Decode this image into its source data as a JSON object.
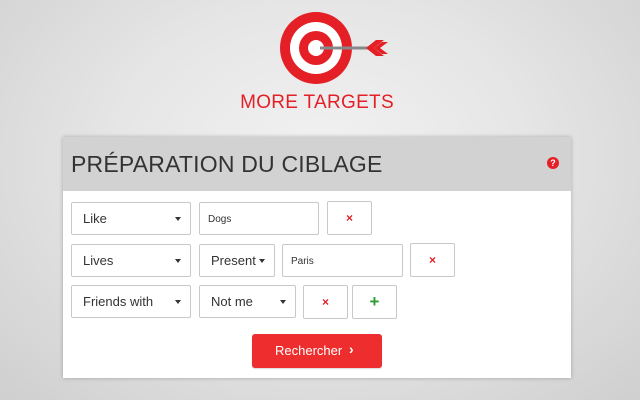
{
  "brand": {
    "name": "MORE TARGETS",
    "color": "#e41f26"
  },
  "panel": {
    "title": "PRÉPARATION DU CIBLAGE",
    "help_icon": "?"
  },
  "rows": [
    {
      "criterion": "Like",
      "value": "Dogs",
      "remove_icon": "×"
    },
    {
      "criterion": "Lives",
      "tense": "Present",
      "value": "Paris",
      "remove_icon": "×"
    },
    {
      "criterion": "Friends with",
      "who": "Not me",
      "remove_icon": "×",
      "add_icon": "+"
    }
  ],
  "search": {
    "label": "Rechercher",
    "icon": "›",
    "color": "#ee2e2e"
  },
  "colors": {
    "accent_red": "#e41f26",
    "add_green": "#2e9c2e",
    "header_gray": "#d2d2d2"
  }
}
